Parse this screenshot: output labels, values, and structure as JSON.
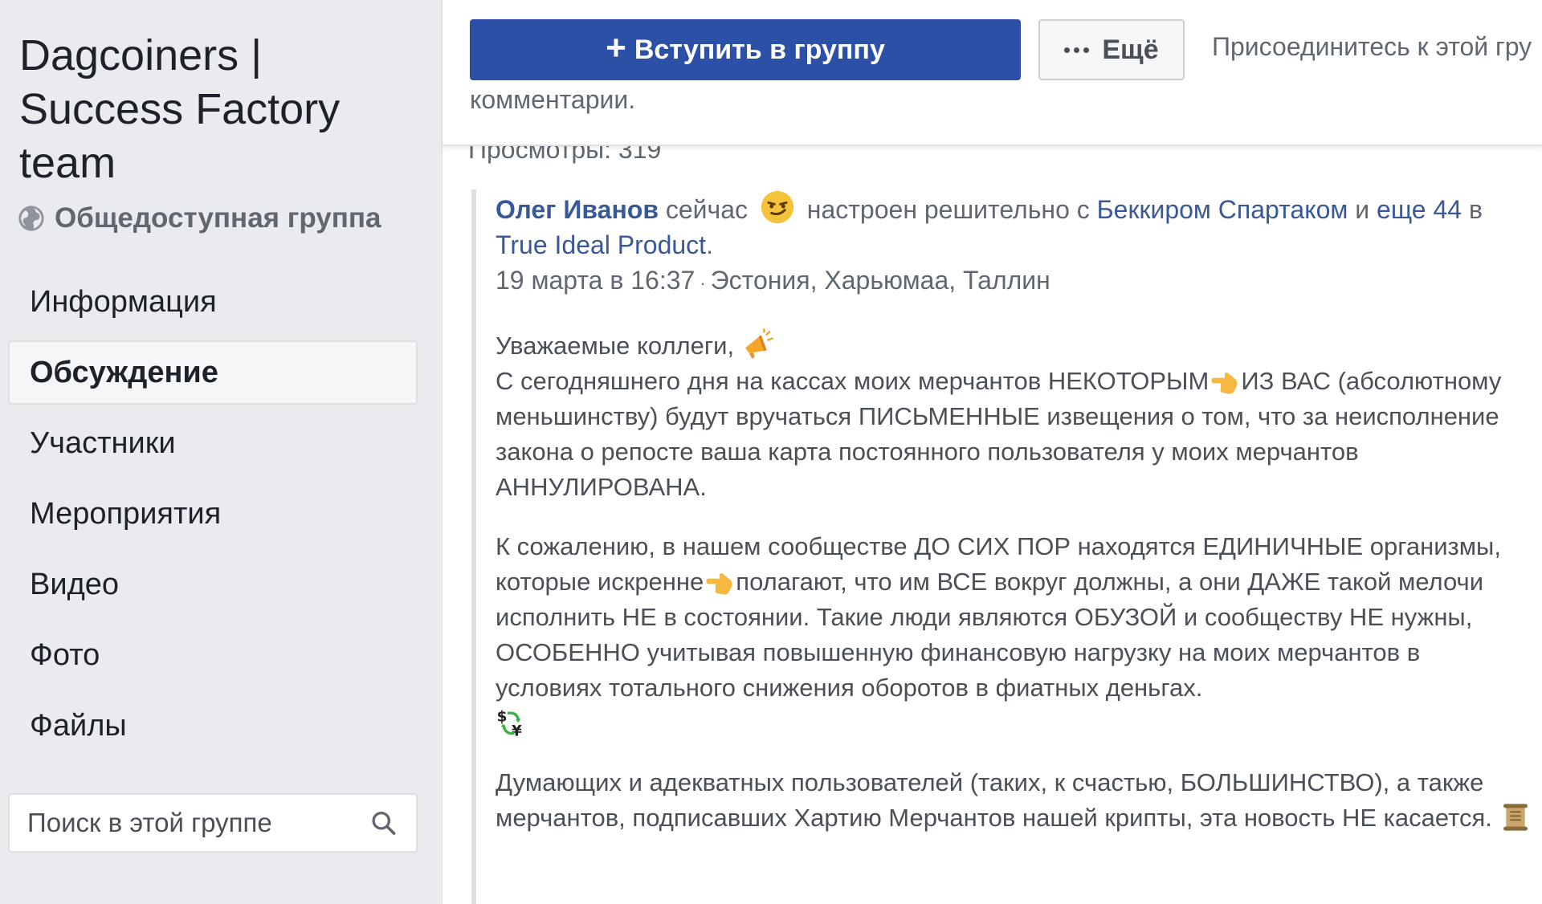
{
  "group": {
    "title": "Dagcoiners | Success Factory team",
    "privacy": "Общедоступная группа"
  },
  "nav": [
    {
      "label": "Информация",
      "active": false
    },
    {
      "label": "Обсуждение",
      "active": true
    },
    {
      "label": "Участники",
      "active": false
    },
    {
      "label": "Мероприятия",
      "active": false
    },
    {
      "label": "Видео",
      "active": false
    },
    {
      "label": "Фото",
      "active": false
    },
    {
      "label": "Файлы",
      "active": false
    }
  ],
  "search": {
    "placeholder": "Поиск в этой группе"
  },
  "header": {
    "join_label": "Вступить в группу",
    "more_label": "Ещё",
    "join_hint": "Присоединитесь к этой гру",
    "comments_text": "комментарии.",
    "views": "Просмотры: 319"
  },
  "post": {
    "author": "Олег Иванов",
    "time_now": "сейчас",
    "feeling": "настроен решительно с",
    "tagged": "Беккиром Спартаком",
    "and": "и",
    "others": "еще 44",
    "in": "в",
    "place": "True Ideal Product",
    "date": "19 марта в 16:37",
    "location": "Эстония, Харьюмаа, Таллин",
    "p1_greeting": "Уважаемые коллеги,",
    "p1_a": "С сегодняшнего дня на кассах моих мерчантов НЕКОТОРЫМ",
    "p1_b": "ИЗ ВАС (абсолютному меньшинству) будут вручаться ПИСЬМЕННЫЕ извещения о том, что за неисполнение закона о репосте ваша карта постоянного пользователя у моих мерчантов АННУЛИРОВАНА.",
    "p2_a": "К сожалению, в нашем сообществе ДО СИХ ПОР находятся ЕДИНИЧНЫЕ организмы, которые искренне",
    "p2_b": "полагают, что им ВСЕ вокруг должны, а они ДАЖЕ такой мелочи исполнить НЕ в состоянии. Такие люди являются ОБУЗОЙ и сообществу НЕ нужны, ОСОБЕННО учитывая повышенную финансовую нагрузку на моих мерчантов в условиях тотального снижения оборотов в фиатных деньгах.",
    "p3": "Думающих и адекватных пользователей (таких, к счастью, БОЛЬШИНСТВО), а также мерчантов, подписавших Хартию Мерчантов нашей крипты, эта новость НЕ касается."
  },
  "colors": {
    "primary": "#2d50a7",
    "link": "#385898",
    "sidebar_bg": "#e9ebee",
    "muted_text": "#606770"
  }
}
